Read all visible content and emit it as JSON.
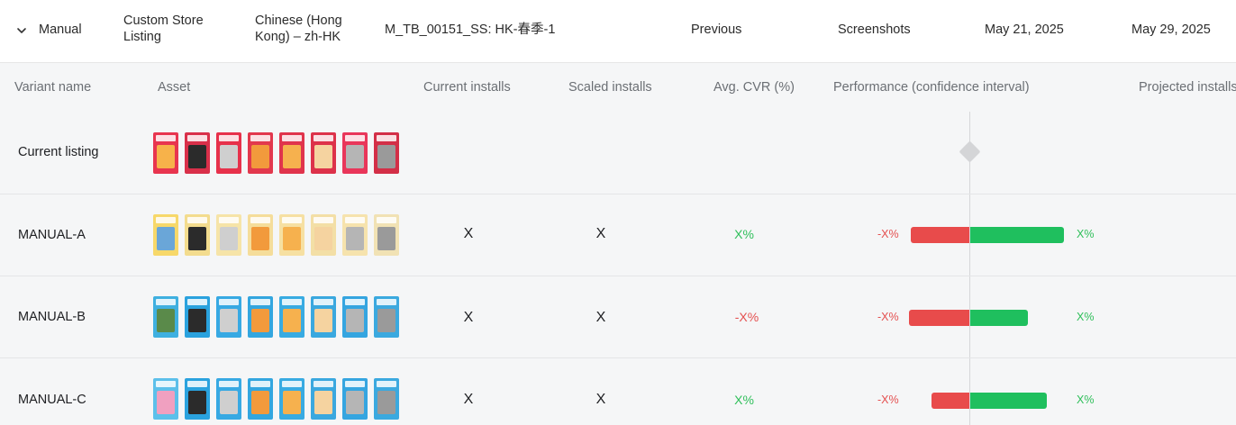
{
  "experiment": {
    "type": "Manual",
    "listing": "Custom Store Listing",
    "locale": "Chinese (Hong Kong) – zh-HK",
    "name": "M_TB_00151_SS: HK-春季-1",
    "status": "Previous",
    "asset_type": "Screenshots",
    "start_date": "May 21, 2025",
    "end_date": "May 29, 2025"
  },
  "columns": {
    "variant_name": "Variant name",
    "asset": "Asset",
    "current_installs": "Current installs",
    "scaled_installs": "Scaled installs",
    "avg_cvr": "Avg. CVR (%)",
    "performance": "Performance (confidence interval)",
    "projected": "Projected installs"
  },
  "rows": [
    {
      "name": "Current listing",
      "thumb_colors": [
        "#e8354f",
        "#d9304a",
        "#e7314b",
        "#e2384d",
        "#e0344c",
        "#dd324a",
        "#e9365a",
        "#d32f47"
      ],
      "thumb_body": [
        "#f7b24a",
        "#2b2b2b",
        "#cfcfcf",
        "#f29a3c",
        "#f6b14e",
        "#f5d3a0",
        "#b5b5b5",
        "#9a9a9a"
      ]
    },
    {
      "name": "MANUAL-A",
      "current_installs": "X",
      "scaled_installs": "X",
      "avg_cvr": "X%",
      "ci_low": "-X%",
      "ci_high": "X%",
      "thumb_colors": [
        "#f7d86a",
        "#f3dc8e",
        "#f6e4a8",
        "#f5dd9a",
        "#f6e0a2",
        "#f3dfa6",
        "#f6e3ad",
        "#f1e2b4"
      ],
      "thumb_body": [
        "#6aa6d8",
        "#2b2b2b",
        "#cfcfcf",
        "#f29a3c",
        "#f6b14e",
        "#f5d3a0",
        "#b5b5b5",
        "#9a9a9a"
      ]
    },
    {
      "name": "MANUAL-B",
      "current_installs": "X",
      "scaled_installs": "X",
      "avg_cvr": "-X%",
      "ci_low": "-X%",
      "ci_high": "X%",
      "thumb_colors": [
        "#3fb0e0",
        "#2aa2de",
        "#37a9e3",
        "#33a6df",
        "#38abe2",
        "#3aa8df",
        "#35a5e0",
        "#3ba9df"
      ],
      "thumb_body": [
        "#5a8a4a",
        "#2b2b2b",
        "#cfcfcf",
        "#f29a3c",
        "#f6b14e",
        "#f5d3a0",
        "#b5b5b5",
        "#9a9a9a"
      ]
    },
    {
      "name": "MANUAL-C",
      "current_installs": "X",
      "scaled_installs": "X",
      "avg_cvr": "X%",
      "ci_low": "-X%",
      "ci_high": "X%",
      "thumb_colors": [
        "#5cc0ea",
        "#2aa2de",
        "#37a9e3",
        "#33a6df",
        "#38abe2",
        "#3aa8df",
        "#35a5e0",
        "#3ba9df"
      ],
      "thumb_body": [
        "#f0a0c0",
        "#2b2b2b",
        "#cfcfcf",
        "#f29a3c",
        "#f6b14e",
        "#f5d3a0",
        "#b5b5b5",
        "#9a9a9a"
      ]
    }
  ],
  "colors": {
    "positive": "#1fbf5e",
    "negative": "#e84b4b"
  }
}
